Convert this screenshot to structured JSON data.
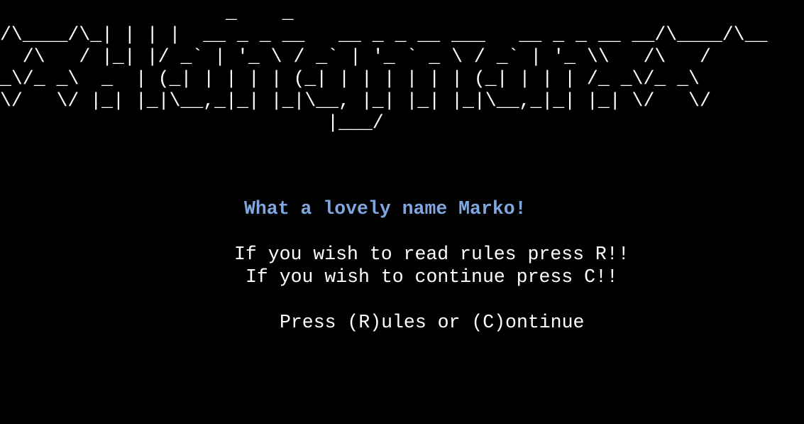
{
  "banner": {
    "lines": [
      "                    _    _",
      "/\\____/\\_| | | |  __ _ _ __   __ _ _ __ ___   __ _ _ __ __/\\____/\\__",
      "  /\\   / |_| |/ _` | '_ \\ / _` | '_ ` _ \\ / _` | '_ \\\\   /\\   /",
      "_\\/_ _\\  _  | (_| | | | | (_| | | | | | | (_| | | | /_ _\\/_ _\\",
      "\\/   \\/ |_| |_|\\__,_|_| |_|\\__, |_| |_| |_|\\__,_|_| |_| \\/   \\/",
      "                             |___/"
    ]
  },
  "greeting": "What a lovely name Marko!",
  "instructions": {
    "rules": "If you wish to read rules press R!!",
    "continue": "If you wish to continue press C!!"
  },
  "prompt": "Press (R)ules or (C)ontinue",
  "colors": {
    "background": "#000000",
    "text": "#ffffff",
    "greeting": "#7fa6de"
  }
}
